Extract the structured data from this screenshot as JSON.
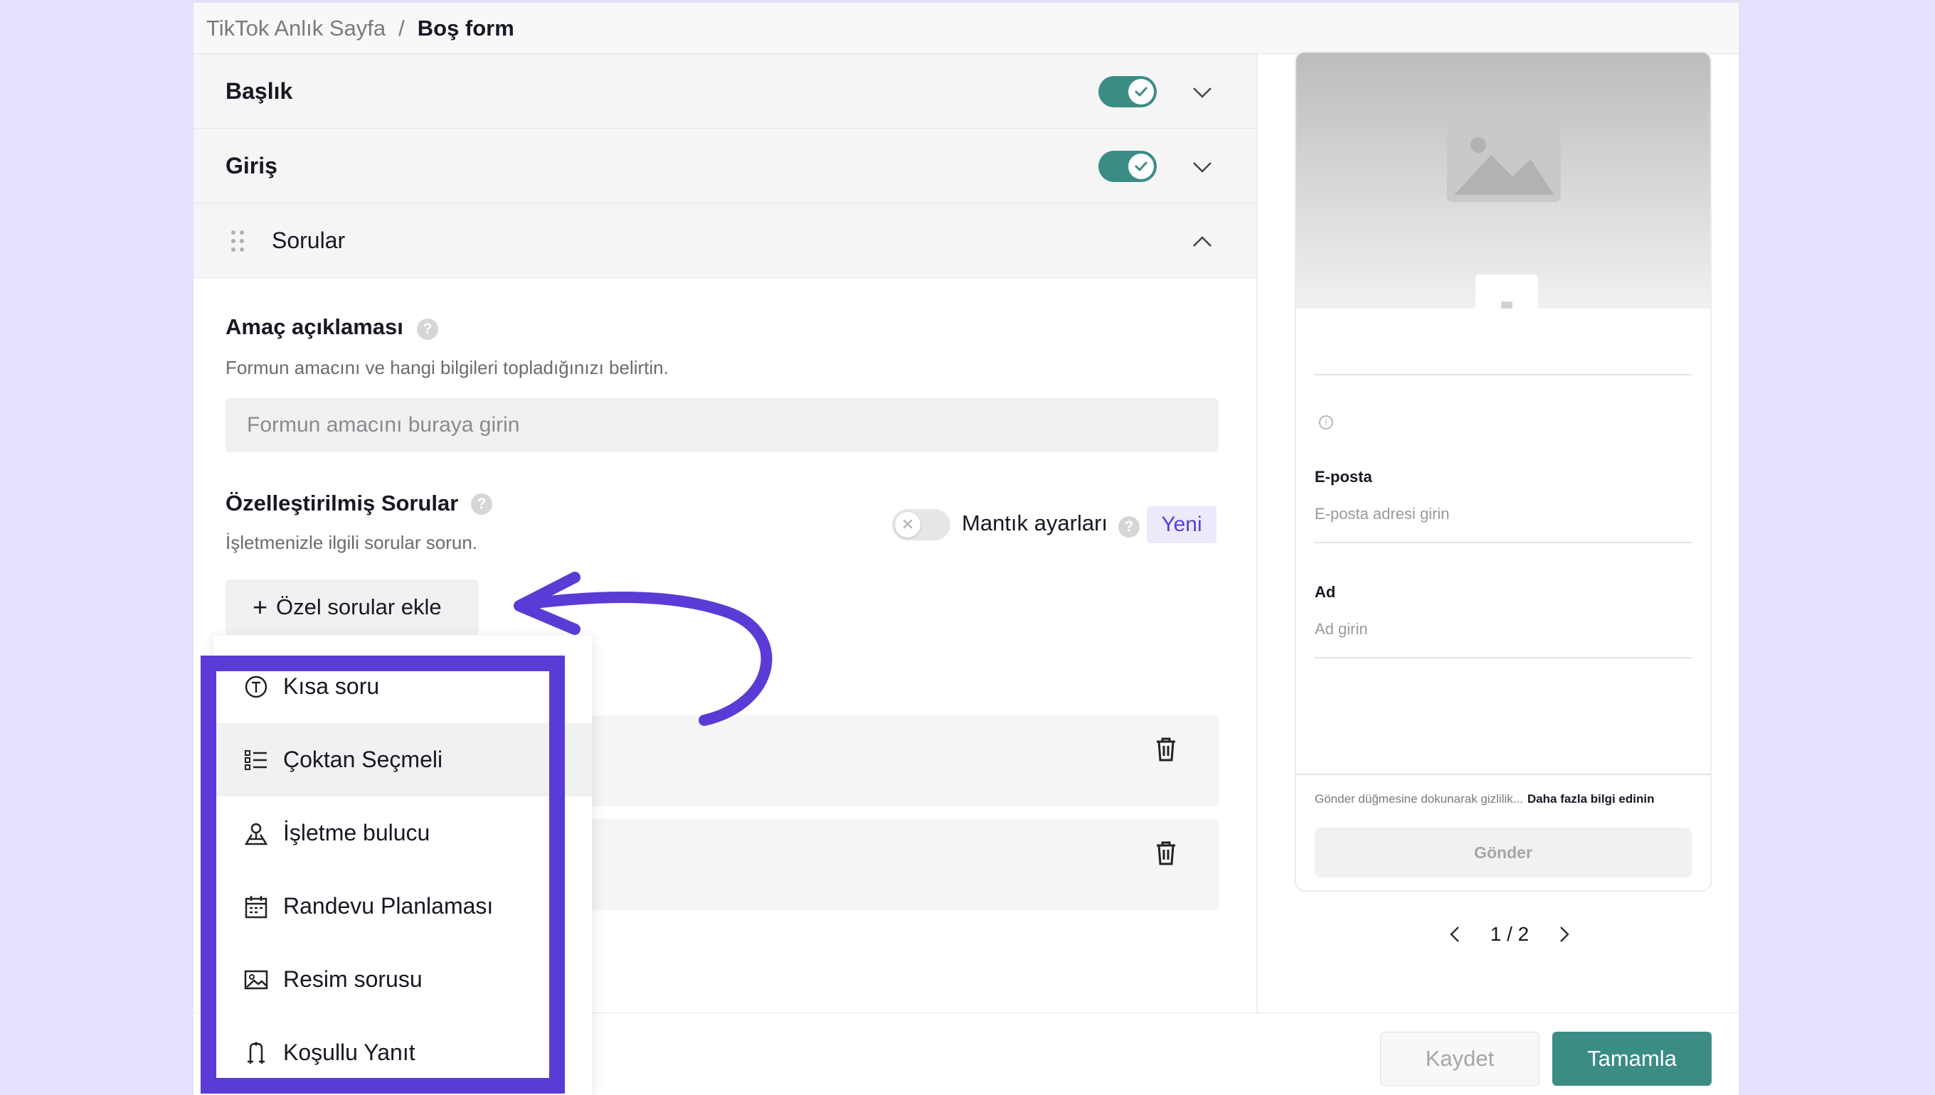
{
  "breadcrumb": {
    "parent": "TikTok Anlık Sayfa",
    "separator": "/",
    "current": "Boş form"
  },
  "sections": {
    "header": {
      "label": "Başlık",
      "enabled": true
    },
    "intro": {
      "label": "Giriş",
      "enabled": true
    },
    "questions": {
      "label": "Sorular"
    }
  },
  "purpose": {
    "title": "Amaç açıklaması",
    "help": "?",
    "description": "Formun amacını ve hangi bilgileri topladığınızı belirtin.",
    "placeholder": "Formun amacını buraya girin"
  },
  "custom_questions": {
    "title": "Özelleştirilmiş Sorular",
    "help": "?",
    "description": "İşletmenizle ilgili sorular sorun.",
    "logic_label": "Mantık ayarları",
    "logic_enabled": false,
    "new_badge": "Yeni",
    "add_button": "Özel sorular ekle",
    "plus": "+"
  },
  "dropdown_menu": {
    "items": [
      {
        "label": "Kısa soru",
        "icon": "text-circle-icon"
      },
      {
        "label": "Çoktan Seçmeli",
        "icon": "list-icon"
      },
      {
        "label": "İşletme bulucu",
        "icon": "location-pin-icon"
      },
      {
        "label": "Randevu Planlaması",
        "icon": "calendar-icon"
      },
      {
        "label": "Resim sorusu",
        "icon": "image-icon"
      },
      {
        "label": "Koşullu Yanıt",
        "icon": "branch-icon"
      }
    ],
    "hovered_index": 1
  },
  "preview": {
    "email_label": "E-posta",
    "email_placeholder": "E-posta adresi girin",
    "name_label": "Ad",
    "name_placeholder": "Ad girin",
    "privacy_note": "Gönder düğmesine dokunarak gizlilik...",
    "learn_more": "Daha fazla bilgi edinin",
    "submit": "Gönder",
    "page_indicator": "1 / 2"
  },
  "footer": {
    "save": "Kaydet",
    "done": "Tamamla"
  },
  "colors": {
    "background": "#e5e0fb",
    "accent_teal": "#3c8c86",
    "highlight_purple": "#5b3bd6",
    "badge_text": "#5a3fd0"
  }
}
